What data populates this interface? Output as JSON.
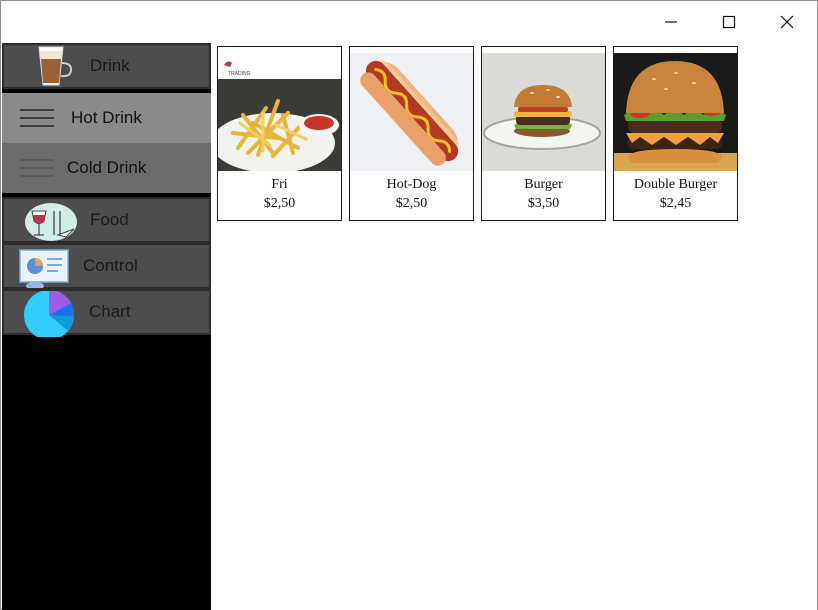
{
  "window": {
    "controls": {
      "minimize_icon": "minimize-icon",
      "maximize_icon": "maximize-icon",
      "close_icon": "close-icon"
    }
  },
  "sidebar": {
    "items": [
      {
        "label": "Drink",
        "icon": "coffee-glass-icon"
      },
      {
        "label": "Hot Drink",
        "icon": "menu-lines-icon",
        "sub": true
      },
      {
        "label": "Cold Drink",
        "icon": "menu-lines-icon",
        "sub": true
      },
      {
        "label": "Food",
        "icon": "food-wine-icon"
      },
      {
        "label": "Control",
        "icon": "dashboard-icon"
      },
      {
        "label": "Chart",
        "icon": "pie-chart-icon"
      }
    ]
  },
  "products": [
    {
      "name": "Fri",
      "price": "$2,50",
      "image": "fries-image",
      "watermark": "TRADING"
    },
    {
      "name": "Hot-Dog",
      "price": "$2,50",
      "image": "hotdog-image"
    },
    {
      "name": "Burger",
      "price": "$3,50",
      "image": "burger-image"
    },
    {
      "name": "Double Burger",
      "price": "$2,45",
      "image": "double-burger-image"
    }
  ],
  "colors": {
    "sidebar_bg": "#000000",
    "nav_item_bg": "#4d4d4d",
    "sub_item_bg": "#8a8a8a",
    "sub_item_dark_bg": "#6b6b6b",
    "accent": "#1e6fd9"
  }
}
